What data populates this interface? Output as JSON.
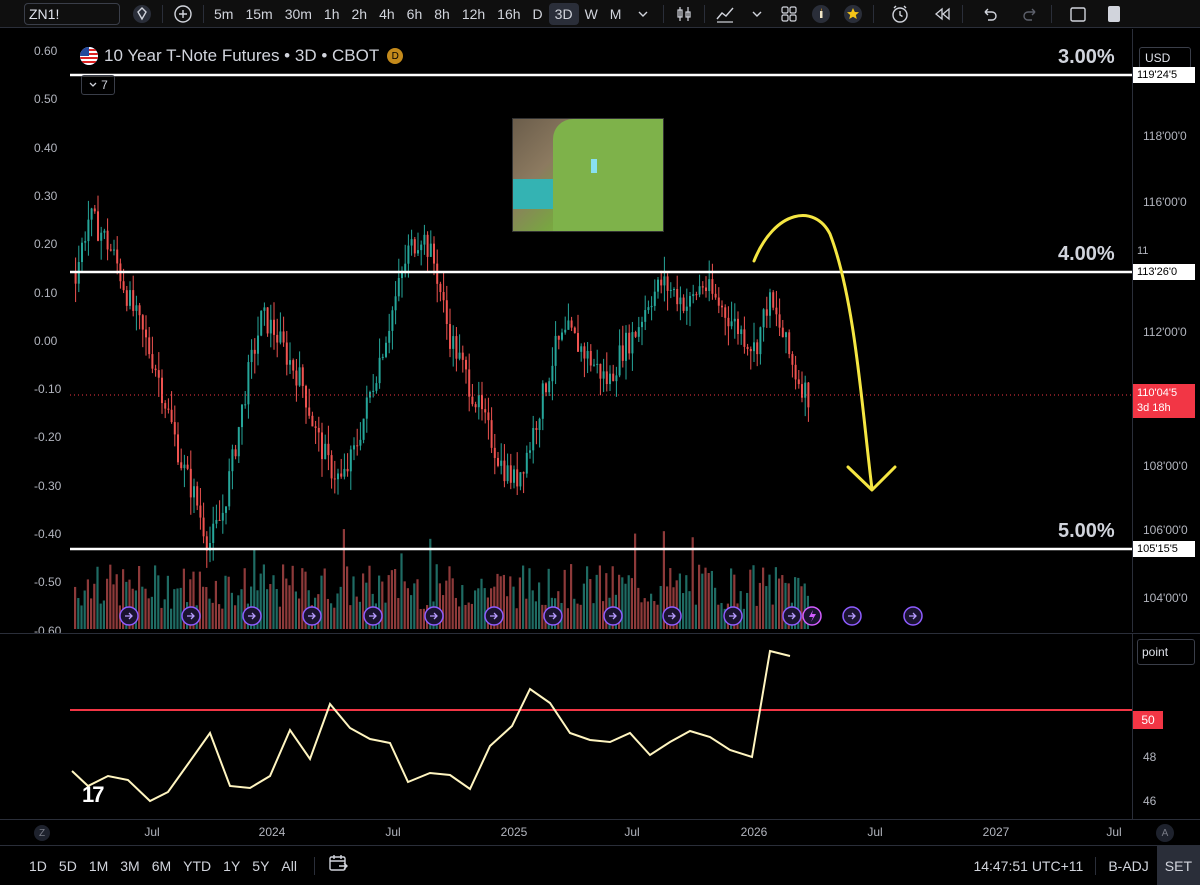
{
  "toolbar": {
    "symbol": "ZN1!",
    "timeframes": [
      "5m",
      "15m",
      "30m",
      "1h",
      "2h",
      "4h",
      "6h",
      "8h",
      "12h",
      "16h",
      "D",
      "3D",
      "W",
      "M"
    ],
    "active_timeframe": "3D"
  },
  "legend": {
    "title": "10 Year T-Note Futures • 3D • CBOT",
    "badge": "D",
    "collapse_count": "7"
  },
  "currency": "USD",
  "left_axis_ticks": [
    "0.60",
    "0.50",
    "0.40",
    "0.30",
    "0.20",
    "0.10",
    "0.00",
    "-0.10",
    "-0.20",
    "-0.30",
    "-0.40",
    "-0.50",
    "-0.60"
  ],
  "right_axis_ticks": [
    "118'00'0",
    "116'00'0",
    "112'00'0",
    "108'00'0",
    "106'00'0",
    "104'00'0"
  ],
  "price_tags": {
    "top": "119'24'5",
    "mid": "113'26'0",
    "bottom": "105'15'5",
    "last": "110'04'5",
    "countdown": "3d 18h",
    "partial": "11"
  },
  "yield_lines": {
    "top_label": "3.00%",
    "mid_label": "4.00%",
    "bottom_label": "5.00%"
  },
  "oscillator": {
    "unit": "point",
    "ticks": [
      "48",
      "46"
    ],
    "level_tag": "50",
    "line_color": "#fff5c0",
    "level_color": "#f23645"
  },
  "time_axis": {
    "ticks": [
      "Jul",
      "2024",
      "Jul",
      "2025",
      "Jul",
      "2026",
      "Jul",
      "2027",
      "Jul"
    ],
    "z_label": "Z",
    "a_label": "A"
  },
  "bottom_bar": {
    "ranges": [
      "1D",
      "5D",
      "1M",
      "3M",
      "6M",
      "YTD",
      "1Y",
      "5Y",
      "All"
    ],
    "clock": "14:47:51 UTC+11",
    "adj": "B-ADJ",
    "session": "SET"
  },
  "colors": {
    "up": "#26a69a",
    "down": "#ef5350",
    "annotation_arrow": "#f5e642",
    "horizontal_line": "#ffffff"
  },
  "chart_data": {
    "type": "candlestick",
    "instrument": "10 Year T-Note Futures",
    "interval": "3D",
    "y_axis_right": {
      "min": 103,
      "max": 120.5,
      "unit": "price (points'32nds)"
    },
    "levels": [
      {
        "label": "3.00%",
        "price": "119'24'5"
      },
      {
        "label": "4.00%",
        "price": "113'26'0"
      },
      {
        "label": "5.00%",
        "price": "105'15'5"
      }
    ],
    "last_price": "110'04'5",
    "close_series_approx": [
      113.8,
      115.5,
      115.0,
      114.2,
      113.0,
      112.0,
      111.0,
      109.5,
      108.0,
      107.0,
      105.6,
      106.5,
      108.6,
      110.8,
      112.5,
      112.0,
      111.2,
      110.5,
      109.0,
      108.0,
      107.5,
      108.5,
      110.0,
      111.5,
      113.0,
      114.5,
      115.0,
      114.0,
      112.0,
      111.0,
      110.0,
      109.0,
      108.0,
      107.5,
      108.5,
      110.0,
      111.5,
      112.0,
      111.5,
      111.0,
      110.5,
      111.5,
      112.0,
      113.0,
      113.5,
      113.2,
      112.8,
      113.5,
      113.0,
      112.5,
      112.0,
      111.5,
      113.0,
      112.0,
      110.8,
      110.1
    ]
  }
}
